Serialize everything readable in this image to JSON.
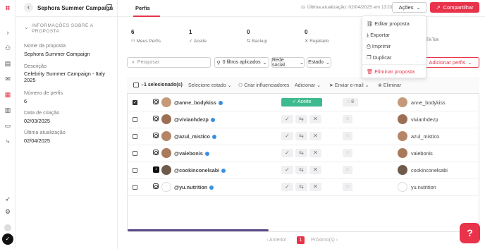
{
  "sidebar": {
    "icons": [
      "logo-icon",
      "chevron-right-icon",
      "users-icon",
      "contacts-icon",
      "mail-icon",
      "calendar-icon",
      "chart-icon",
      "wallet-icon",
      "flow-icon",
      "rocket-icon",
      "settings-icon"
    ]
  },
  "panel": {
    "title": "Sephora Summer Campaign",
    "section": "INFORMAÇÕES SOBRE A PROPOSTA",
    "fields": [
      {
        "label": "Nome da proposta",
        "value": "Sephora Summer Campaign"
      },
      {
        "label": "Descrição",
        "value": "Celebrity Summer Campaign - Italy 2025"
      },
      {
        "label": "Número de perfis",
        "value": "6"
      },
      {
        "label": "Data de criação",
        "value": "02/03/2025"
      },
      {
        "label": "Última atualização",
        "value": "02/04/2025"
      }
    ]
  },
  "header": {
    "tab": "Perfis",
    "updated": "Última atualização: 02/04/2025 em 13:01",
    "actions": "Ações",
    "share": "Compartilhar"
  },
  "actions_menu": [
    "Editar proposta",
    "Exportar",
    "Imprimir",
    "Duplicar",
    "Eliminar proposta"
  ],
  "stats": [
    {
      "value": "6",
      "label": "Meus Perfis"
    },
    {
      "value": "1",
      "label": "Aceite"
    },
    {
      "value": "0",
      "label": "Backup"
    },
    {
      "value": "0",
      "label": "Rejeitado"
    },
    {
      "value": "",
      "label": "TikTok"
    }
  ],
  "filters": {
    "search_placeholder": "Pesquisar",
    "applied": "0 filtros aplicados",
    "network": "Rede social",
    "status": "Estado",
    "add_profiles": "Adicionar perfis"
  },
  "bulk": {
    "selected": "1 selecionado(s)",
    "select_status": "Selecione estado",
    "create": "Criar influenciadores",
    "add": "Adicionar",
    "send_email": "Enviar e-mail",
    "delete": "Eliminar"
  },
  "rows": [
    {
      "handle": "@anne_bodykiss",
      "name": "anne_bodykiss",
      "comments": "8",
      "accepted": "Aceite",
      "network": "instagram"
    },
    {
      "handle": "@vivianhdezp",
      "name": "vivianhdezp",
      "comments": "",
      "network": "instagram"
    },
    {
      "handle": "@azul_mistico",
      "name": "azul_mistico",
      "comments": "",
      "network": "instagram"
    },
    {
      "handle": "@valebonis",
      "name": "valebonis",
      "comments": "",
      "network": "instagram"
    },
    {
      "handle": "@cookinconelsabi",
      "name": "cookinconelsabi",
      "comments": "",
      "network": "tiktok"
    },
    {
      "handle": "@yu.nutrition",
      "name": "yu.nutrition",
      "comments": "",
      "network": "instagram"
    }
  ],
  "pagination": {
    "prev": "Anterior",
    "page": "1",
    "next": "Próximo(s)"
  },
  "colors": {
    "brand": "#e8334a",
    "accepted": "#3dbb8f",
    "verified": "#3b8fe0"
  }
}
